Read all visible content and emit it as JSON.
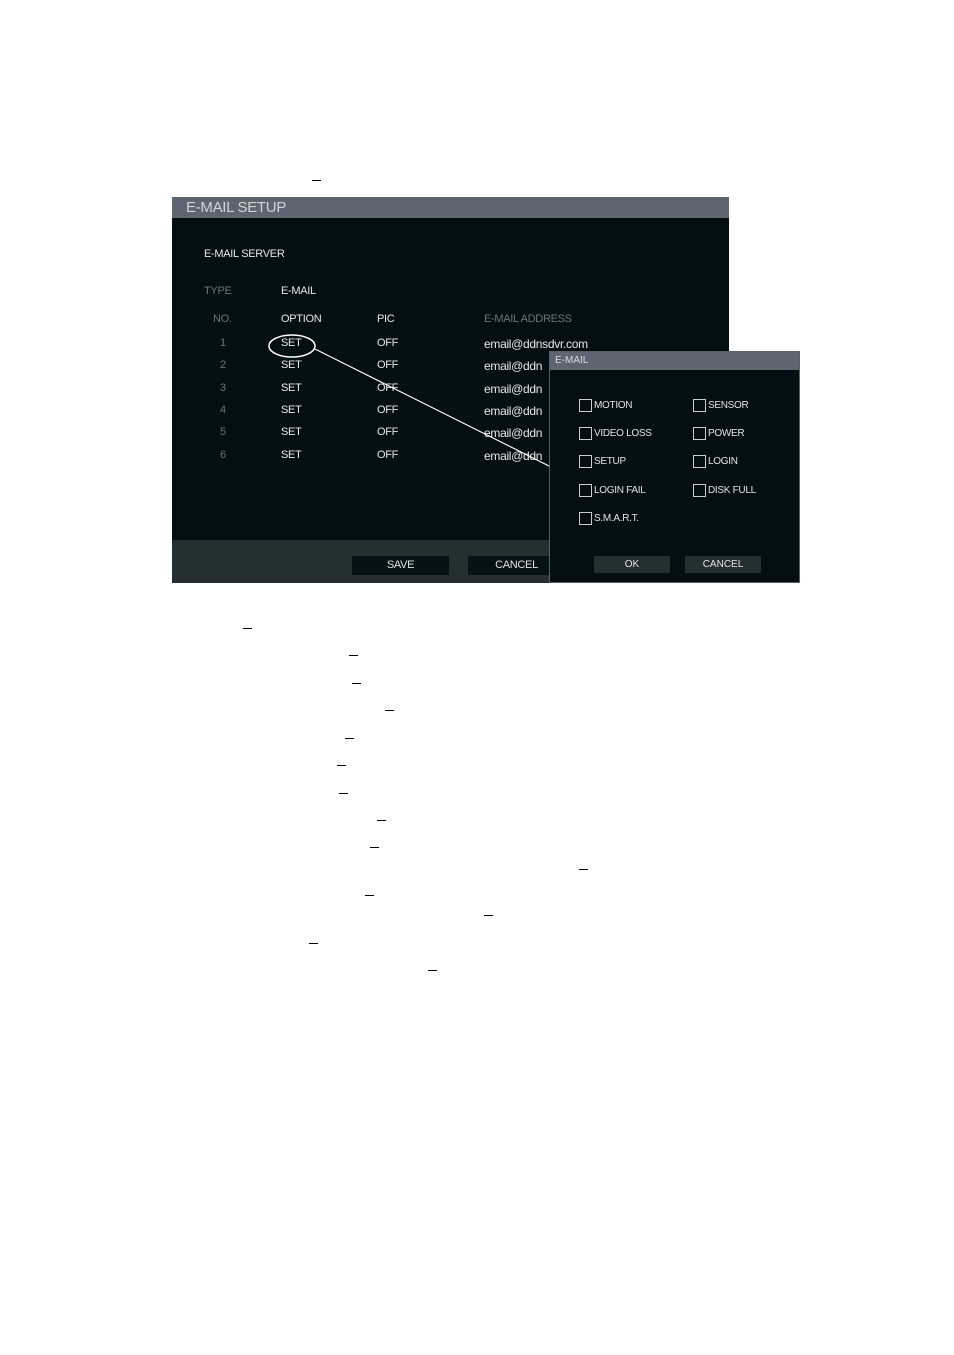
{
  "window": {
    "title": "E-MAIL SETUP",
    "section_label": "E-MAIL SERVER",
    "type_label": "TYPE",
    "type_value": "E-MAIL"
  },
  "table": {
    "headers": {
      "no": "NO.",
      "option": "OPTION",
      "pic": "PIC",
      "address": "E-MAIL ADDRESS"
    },
    "rows": [
      {
        "no": "1",
        "option": "SET",
        "pic": "OFF",
        "address": "email@ddnsdvr.com"
      },
      {
        "no": "2",
        "option": "SET",
        "pic": "OFF",
        "address": "email@ddn"
      },
      {
        "no": "3",
        "option": "SET",
        "pic": "OFF",
        "address": "email@ddn"
      },
      {
        "no": "4",
        "option": "SET",
        "pic": "OFF",
        "address": "email@ddn"
      },
      {
        "no": "5",
        "option": "SET",
        "pic": "OFF",
        "address": "email@ddn"
      },
      {
        "no": "6",
        "option": "SET",
        "pic": "OFF",
        "address": "email@ddn"
      }
    ]
  },
  "footer": {
    "save_label": "SAVE",
    "cancel_label": "CANCEL"
  },
  "popup": {
    "title": "E-MAIL",
    "options": [
      {
        "label": "MOTION",
        "checked": false
      },
      {
        "label": "SENSOR",
        "checked": false
      },
      {
        "label": "VIDEO LOSS",
        "checked": false
      },
      {
        "label": "POWER",
        "checked": false
      },
      {
        "label": "SETUP",
        "checked": false
      },
      {
        "label": "LOGIN",
        "checked": false
      },
      {
        "label": "LOGIN FAIL",
        "checked": false
      },
      {
        "label": "DISK FULL",
        "checked": false
      },
      {
        "label": "S.M.A.R.T.",
        "checked": false
      }
    ],
    "ok_label": "OK",
    "cancel_label": "CANCEL"
  },
  "colors": {
    "panel_bg": "#030f12",
    "title_bar": "#5d6670",
    "footer_bg": "#232f31",
    "text": "#e6e9ea",
    "muted_text": "#69757a"
  }
}
